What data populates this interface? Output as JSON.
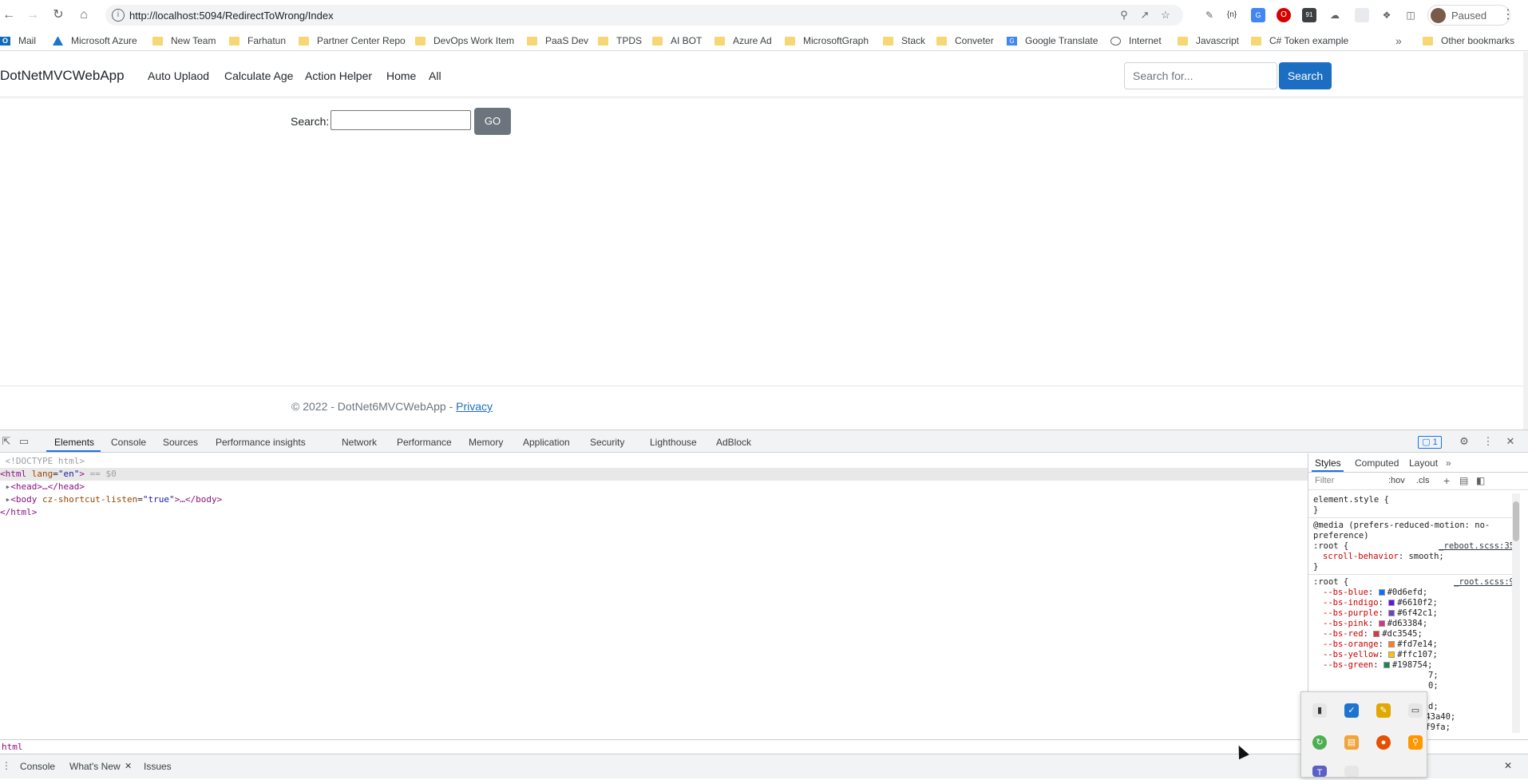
{
  "browser": {
    "url": "http://localhost:5094/RedirectToWrong/Index",
    "profile_label": "Paused",
    "extension_badge": "91"
  },
  "bookmarks": [
    {
      "label": "Mail",
      "icon": "outlook-icon"
    },
    {
      "label": "Microsoft Azure",
      "icon": "azure-icon"
    },
    {
      "label": "New Team",
      "icon": "folder-icon"
    },
    {
      "label": "Farhatun",
      "icon": "folder-icon"
    },
    {
      "label": "Partner Center Repo",
      "icon": "folder-icon"
    },
    {
      "label": "DevOps Work Item",
      "icon": "folder-icon"
    },
    {
      "label": "PaaS Dev",
      "icon": "folder-icon"
    },
    {
      "label": "TPDS",
      "icon": "folder-icon"
    },
    {
      "label": "AI BOT",
      "icon": "folder-icon"
    },
    {
      "label": "Azure Ad",
      "icon": "folder-icon"
    },
    {
      "label": "MicrosoftGraph",
      "icon": "folder-icon"
    },
    {
      "label": "Stack",
      "icon": "folder-icon"
    },
    {
      "label": "Conveter",
      "icon": "folder-icon"
    },
    {
      "label": "Google Translate",
      "icon": "google-translate-icon"
    },
    {
      "label": "Internet",
      "icon": "globe-icon"
    },
    {
      "label": "Javascript",
      "icon": "folder-icon"
    },
    {
      "label": "C# Token example",
      "icon": "folder-icon"
    }
  ],
  "other_bookmarks": "Other bookmarks",
  "page": {
    "brand": "DotNetMVCWebApp",
    "nav": [
      "Auto Uplaod",
      "Calculate Age",
      "Action Helper",
      "Home",
      "All"
    ],
    "search_placeholder": "Search for...",
    "search_button": "Search",
    "search_label": "Search:",
    "go_button": "GO",
    "footer_text": "© 2022 - DotNet6MVCWebApp - ",
    "footer_link": "Privacy"
  },
  "devtools": {
    "tabs": [
      "Elements",
      "Console",
      "Sources",
      "Performance insights",
      "Network",
      "Performance",
      "Memory",
      "Application",
      "Security",
      "Lighthouse",
      "AdBlock"
    ],
    "issues_count": "1",
    "dom": {
      "doctype": "<!DOCTYPE html>",
      "html_open_tag": "html",
      "html_attr": "lang",
      "html_attr_val": "\"en\"",
      "html_selected": " == $0",
      "head": "<head>…</head>",
      "body_tag": "body",
      "body_attr": "cz-shortcut-listen",
      "body_attr_val": "\"true\"",
      "body_rest": ">…</body>",
      "html_close": "</html>"
    },
    "styles_tabs": [
      "Styles",
      "Computed",
      "Layout"
    ],
    "filter_placeholder": "Filter",
    "hov": ":hov",
    "cls": ".cls",
    "rules": {
      "element_style": "element.style {",
      "close": "}",
      "media": "@media (prefers-reduced-motion: no-",
      "media2": "preference)",
      "root": ":root {",
      "reboot_src": "_reboot.scss:35",
      "scroll_prop": "scroll-behavior",
      "scroll_val": ": smooth;",
      "root_src": "_root.scss:9",
      "vars": [
        {
          "name": "--bs-blue",
          "val": "#0d6efd;",
          "color": "#0d6efd"
        },
        {
          "name": "--bs-indigo",
          "val": "#6610f2;",
          "color": "#6610f2"
        },
        {
          "name": "--bs-purple",
          "val": "#6f42c1;",
          "color": "#6f42c1"
        },
        {
          "name": "--bs-pink",
          "val": "#d63384;",
          "color": "#d63384"
        },
        {
          "name": "--bs-red",
          "val": "#dc3545;",
          "color": "#dc3545"
        },
        {
          "name": "--bs-orange",
          "val": "#fd7e14;",
          "color": "#fd7e14"
        },
        {
          "name": "--bs-yellow",
          "val": "#ffc107;",
          "color": "#ffc107"
        },
        {
          "name": "--bs-green",
          "val": "#198754;",
          "color": "#198754"
        }
      ],
      "partial1": "7;",
      "partial2": "0;",
      "partial3": "d;",
      "partial4": "343a40;",
      "partial5": "8f9fa;"
    },
    "breadcrumb": "html",
    "drawer_tabs": [
      "Console",
      "What's New",
      "Issues"
    ]
  },
  "colors": {
    "accent": "#1b6ec2",
    "go_button": "#6c757d"
  }
}
